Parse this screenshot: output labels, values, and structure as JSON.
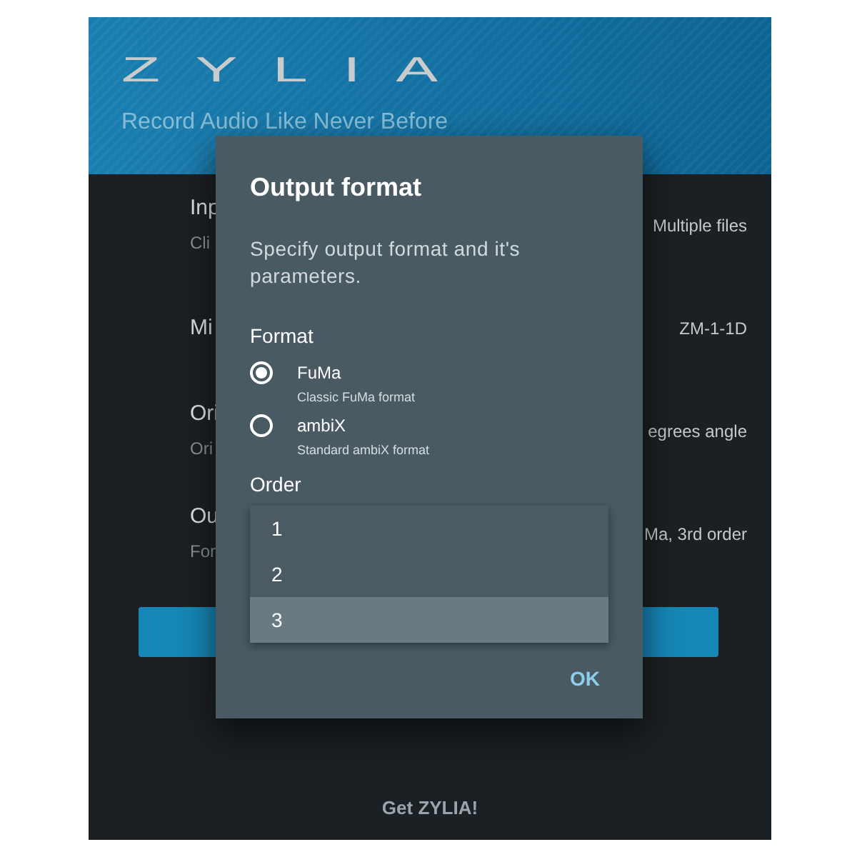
{
  "header": {
    "logo": "ZYLIA",
    "tagline": "Record Audio Like Never Before"
  },
  "settings": [
    {
      "label": "Inp",
      "sublabel": "Cli",
      "value": "Multiple files"
    },
    {
      "label": "Mi",
      "value": "ZM-1-1D"
    },
    {
      "label": "Ori",
      "sublabel": "Ori",
      "value": "egrees angle"
    },
    {
      "label": "Ou",
      "sublabel": "For",
      "value": "Ma, 3rd order"
    }
  ],
  "footer": {
    "link": "Get ZYLIA!"
  },
  "dialog": {
    "title": "Output format",
    "description": "Specify output format and it's parameters.",
    "format_label": "Format",
    "formats": [
      {
        "name": "FuMa",
        "description": "Classic FuMa format",
        "selected": true
      },
      {
        "name": "ambiX",
        "description": "Standard ambiX format",
        "selected": false
      }
    ],
    "order_label": "Order",
    "orders": [
      {
        "label": "1",
        "selected": false
      },
      {
        "label": "2",
        "selected": false
      },
      {
        "label": "3",
        "selected": true
      }
    ],
    "ok": "OK"
  }
}
